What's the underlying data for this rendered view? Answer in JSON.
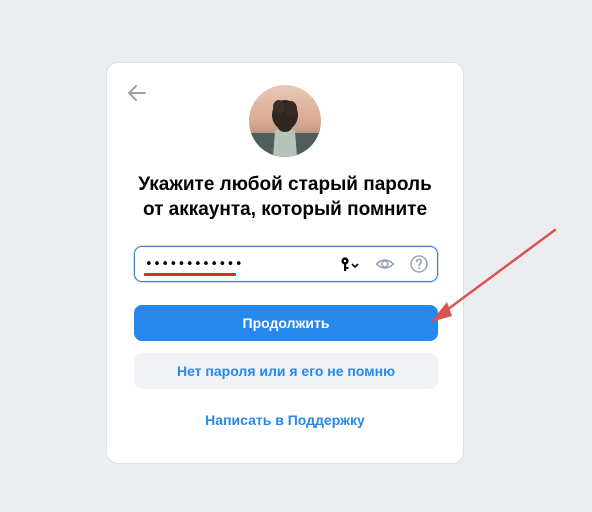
{
  "card": {
    "title_line1": "Укажите любой старый пароль",
    "title_line2": "от аккаунта, который помните"
  },
  "password_field": {
    "value": "••••••••••••",
    "type": "password"
  },
  "icons": {
    "back": "back-arrow-icon",
    "key": "key-icon",
    "visibility": "eye-icon",
    "help": "question-mark-icon"
  },
  "buttons": {
    "continue_label": "Продолжить",
    "no_password_label": "Нет пароля или я его не помню",
    "support_link_label": "Написать в Поддержку"
  },
  "colors": {
    "accent": "#2688eb",
    "annotation": "#d9534f",
    "background": "#ebedf0"
  }
}
